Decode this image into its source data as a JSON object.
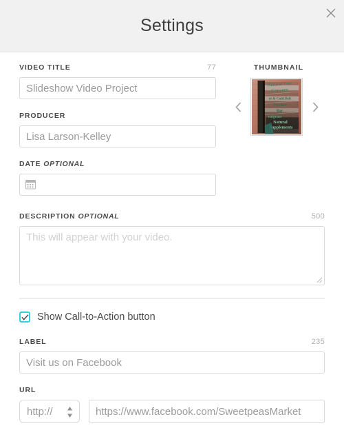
{
  "header": {
    "title": "Settings",
    "close_icon": "close-icon"
  },
  "form": {
    "video_title": {
      "label": "VIDEO TITLE",
      "counter": "77",
      "value": "Slideshow Video Project"
    },
    "producer": {
      "label": "PRODUCER",
      "value": "Lisa Larson-Kelley"
    },
    "date": {
      "label": "DATE",
      "optional": "OPTIONAL",
      "value": "",
      "icon": "calendar-icon"
    },
    "description": {
      "label": "DESCRIPTION",
      "optional": "OPTIONAL",
      "counter": "500",
      "placeholder": "This will appear with your video.",
      "value": ""
    }
  },
  "thumbnail": {
    "label": "THUMBNAIL",
    "prev_icon": "chevron-left-icon",
    "next_icon": "chevron-right-icon",
    "image_alt": "Natural Foods Grocery storefront sign painted on brick wall",
    "sign_lines": [
      "Natural Foods",
      "Grocery",
      "Hot & Cold Deli",
      "Produce",
      "Bar",
      "Wheatgrass",
      "Natural",
      "Supplements"
    ]
  },
  "cta": {
    "checkbox_label": "Show Call-to-Action button",
    "checked": true,
    "accent_color": "#2ed3d8",
    "label_field": {
      "label": "LABEL",
      "counter": "235",
      "value": "Visit us on Facebook"
    },
    "url_field": {
      "label": "URL",
      "protocol": "http://",
      "value": "https://www.facebook.com/SweetpeasMarket"
    }
  }
}
